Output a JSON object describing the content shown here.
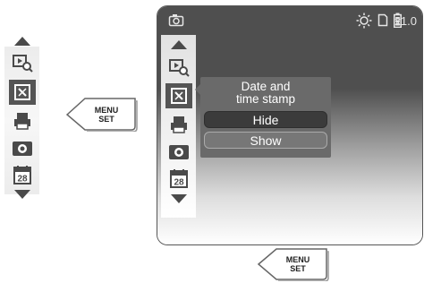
{
  "left_menu": {
    "items": [
      {
        "icon": "playback-zoom-icon",
        "selected": false
      },
      {
        "icon": "date-time-stamp-icon",
        "selected": true
      },
      {
        "icon": "printer-icon",
        "selected": false
      },
      {
        "icon": "camera-icon",
        "selected": false
      },
      {
        "icon": "calendar-icon",
        "selected": false,
        "label": "28"
      }
    ]
  },
  "softkey": {
    "line1": "MENU",
    "line2": "SET"
  },
  "screen": {
    "status": {
      "mode_icon": "camera-mode-icon",
      "brightness_icon": "brightness-icon",
      "sd_icon": "sd-card-icon",
      "battery_icon": "battery-icon",
      "zoom": "x1.0"
    },
    "popup": {
      "title_line1": "Date and",
      "title_line2": "time stamp",
      "options": [
        "Hide",
        "Show"
      ],
      "selected_option": "Hide"
    }
  },
  "colors": {
    "screen_dark": "#4f4f4f",
    "popup_bg": "#6a6a6a",
    "selected_option_bg": "#3b3b3b",
    "icon_color": "#4a4a4a"
  }
}
